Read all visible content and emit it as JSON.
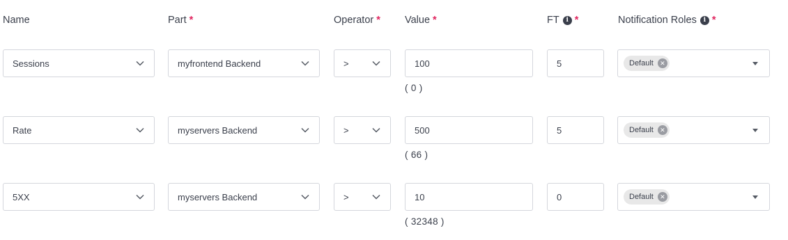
{
  "headers": {
    "name": "Name",
    "part": "Part",
    "operator": "Operator",
    "value": "Value",
    "ft": "FT",
    "roles": "Notification Roles",
    "required_mark": "*",
    "info_glyph": "i"
  },
  "rows": [
    {
      "name": "Sessions",
      "part": "myfrontend Backend",
      "operator": ">",
      "value": "100",
      "current": "( 0 )",
      "ft": "5",
      "role_chip": "Default"
    },
    {
      "name": "Rate",
      "part": "myservers Backend",
      "operator": ">",
      "value": "500",
      "current": "( 66 )",
      "ft": "5",
      "role_chip": "Default"
    },
    {
      "name": "5XX",
      "part": "myservers Backend",
      "operator": ">",
      "value": "10",
      "current": "( 32348 )",
      "ft": "0",
      "role_chip": "Default"
    }
  ],
  "icons": {
    "dropdown": "chevron-down-icon",
    "remove_chip": "close-circle-icon",
    "multi_dropdown": "caret-down-icon",
    "info": "info-circle-icon"
  },
  "colors": {
    "required": "#e0245e",
    "border": "#d4d6dc",
    "chip_bg": "#e8e8e8"
  }
}
